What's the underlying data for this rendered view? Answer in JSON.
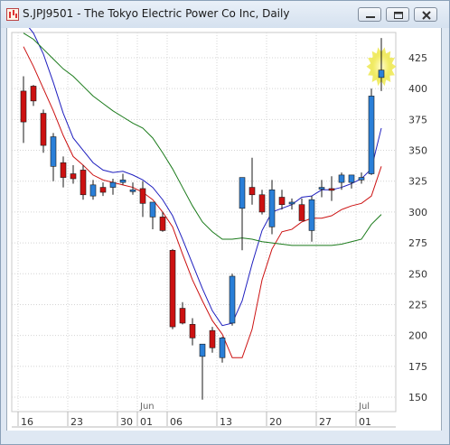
{
  "window": {
    "title": "S.JPJ9501 - The Tokyo Electric Power Co Inc, Daily",
    "buttons": [
      "minimize",
      "restore",
      "close"
    ]
  },
  "chart_data": {
    "type": "candlestick",
    "title": "S.JPJ9501 - The Tokyo Electric Power Co Inc, Daily",
    "ylim": [
      130,
      450
    ],
    "y_ticks": [
      150,
      175,
      200,
      225,
      250,
      275,
      300,
      325,
      350,
      375,
      400,
      425
    ],
    "x_ticks": [
      {
        "label": "16",
        "index": 0
      },
      {
        "label": "23",
        "index": 5
      },
      {
        "label": "30",
        "index": 10
      },
      {
        "label": "01",
        "index": 12
      },
      {
        "label": "06",
        "index": 15
      },
      {
        "label": "13",
        "index": 20
      },
      {
        "label": "20",
        "index": 25
      },
      {
        "label": "27",
        "index": 30
      },
      {
        "label": "01",
        "index": 34
      }
    ],
    "month_labels": [
      {
        "label": "Jun",
        "index": 12
      },
      {
        "label": "Jul",
        "index": 34
      }
    ],
    "candles": [
      {
        "o": 398,
        "h": 410,
        "l": 356,
        "c": 373
      },
      {
        "o": 402,
        "h": 403,
        "l": 386,
        "c": 390
      },
      {
        "o": 380,
        "h": 383,
        "l": 348,
        "c": 354
      },
      {
        "o": 337,
        "h": 364,
        "l": 325,
        "c": 361
      },
      {
        "o": 340,
        "h": 345,
        "l": 320,
        "c": 328
      },
      {
        "o": 331,
        "h": 338,
        "l": 323,
        "c": 327
      },
      {
        "o": 334,
        "h": 338,
        "l": 310,
        "c": 314
      },
      {
        "o": 313,
        "h": 326,
        "l": 310,
        "c": 322
      },
      {
        "o": 320,
        "h": 324,
        "l": 313,
        "c": 316
      },
      {
        "o": 320,
        "h": 327,
        "l": 314,
        "c": 324
      },
      {
        "o": 324,
        "h": 331,
        "l": 322,
        "c": 326
      },
      {
        "o": 318,
        "h": 324,
        "l": 314,
        "c": 318
      },
      {
        "o": 319,
        "h": 325,
        "l": 296,
        "c": 307
      },
      {
        "o": 296,
        "h": 307,
        "l": 286,
        "c": 308
      },
      {
        "o": 296,
        "h": 300,
        "l": 284,
        "c": 285
      },
      {
        "o": 269,
        "h": 270,
        "l": 205,
        "c": 207
      },
      {
        "o": 222,
        "h": 227,
        "l": 209,
        "c": 210
      },
      {
        "o": 209,
        "h": 214,
        "l": 192,
        "c": 198
      },
      {
        "o": 183,
        "h": 191,
        "l": 148,
        "c": 193
      },
      {
        "o": 204,
        "h": 207,
        "l": 186,
        "c": 190
      },
      {
        "o": 182,
        "h": 199,
        "l": 178,
        "c": 198
      },
      {
        "o": 210,
        "h": 250,
        "l": 208,
        "c": 248
      },
      {
        "o": 303,
        "h": 328,
        "l": 269,
        "c": 328
      },
      {
        "o": 320,
        "h": 344,
        "l": 306,
        "c": 314
      },
      {
        "o": 314,
        "h": 318,
        "l": 298,
        "c": 300
      },
      {
        "o": 288,
        "h": 326,
        "l": 282,
        "c": 318
      },
      {
        "o": 312,
        "h": 318,
        "l": 302,
        "c": 306
      },
      {
        "o": 307,
        "h": 311,
        "l": 302,
        "c": 308
      },
      {
        "o": 306,
        "h": 311,
        "l": 294,
        "c": 293
      },
      {
        "o": 285,
        "h": 313,
        "l": 276,
        "c": 310
      },
      {
        "o": 320,
        "h": 326,
        "l": 312,
        "c": 320
      },
      {
        "o": 319,
        "h": 329,
        "l": 309,
        "c": 318
      },
      {
        "o": 324,
        "h": 332,
        "l": 318,
        "c": 330
      },
      {
        "o": 324,
        "h": 330,
        "l": 319,
        "c": 330
      },
      {
        "o": 326,
        "h": 332,
        "l": 323,
        "c": 328
      },
      {
        "o": 331,
        "h": 400,
        "l": 330,
        "c": 394
      },
      {
        "o": 409,
        "h": 441,
        "l": 398,
        "c": 415
      }
    ],
    "series": [
      {
        "color": "#cc1111",
        "values": [
          434,
          418,
          400,
          382,
          362,
          345,
          338,
          330,
          326,
          324,
          322,
          320,
          316,
          310,
          300,
          288,
          266,
          245,
          228,
          212,
          201,
          182,
          182,
          205,
          245,
          270,
          284,
          286,
          292,
          295,
          295,
          297,
          302,
          305,
          307,
          313,
          337
        ]
      },
      {
        "color": "#1f1fbf",
        "values": [
          455,
          445,
          428,
          405,
          380,
          360,
          350,
          340,
          334,
          332,
          333,
          330,
          326,
          320,
          310,
          297,
          278,
          258,
          238,
          220,
          208,
          210,
          228,
          258,
          285,
          300,
          303,
          306,
          312,
          313,
          318,
          318,
          320,
          323,
          327,
          335,
          368
        ]
      },
      {
        "color": "#1a7a1a",
        "values": [
          445,
          440,
          432,
          424,
          416,
          410,
          402,
          394,
          388,
          382,
          377,
          372,
          368,
          360,
          348,
          335,
          320,
          305,
          292,
          284,
          278,
          278,
          279,
          278,
          276,
          275,
          274,
          273,
          273,
          273,
          273,
          273,
          274,
          276,
          278,
          290,
          298
        ]
      }
    ],
    "up_color": "#2a7fd8",
    "down_color": "#cc1111",
    "grid": true,
    "highlight": "last-candle"
  }
}
